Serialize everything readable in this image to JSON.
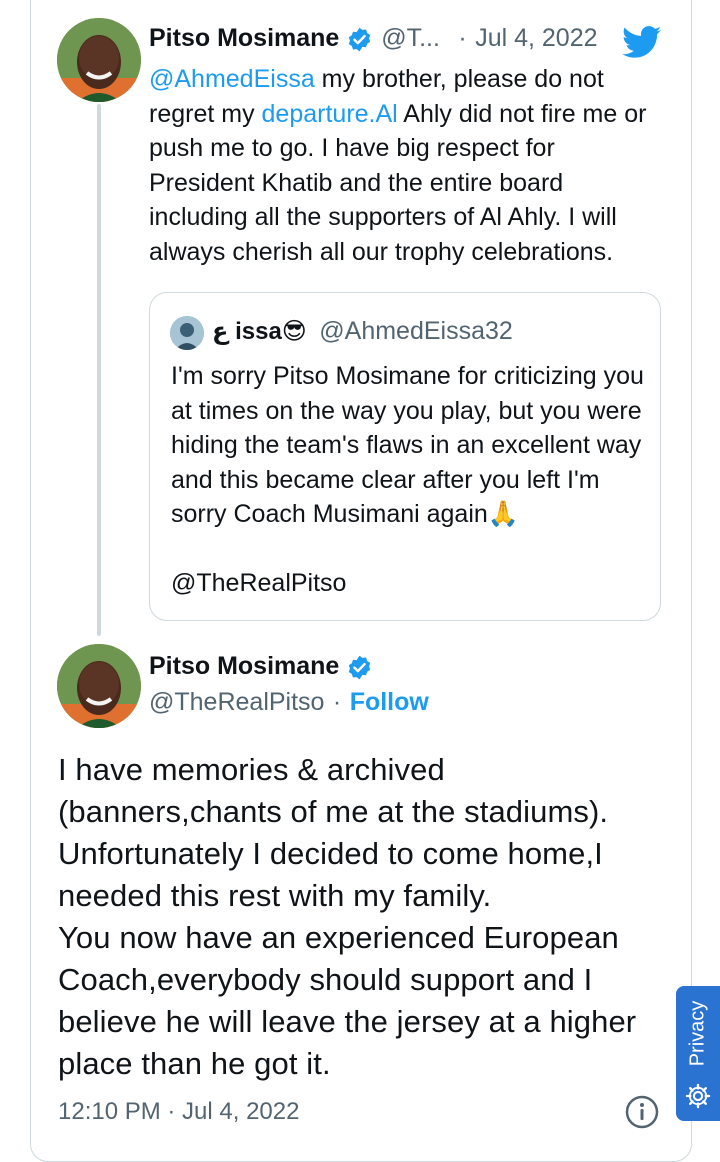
{
  "reply_tweet": {
    "author_name": "Pitso Mosimane",
    "author_handle": "@T...",
    "separator": "·",
    "date": "Jul 4, 2022",
    "mention": "@AhmedEissa",
    "text_part1": " my brother, please do not regret my ",
    "link_text": "departure.Al",
    "text_part2": " Ahly did not fire me or push me to go. I have big respect for President Khatib and the entire board including all the supporters of Al Ahly. I will always cherish all our trophy celebrations."
  },
  "quoted_tweet": {
    "author_name": "ع issa😎",
    "author_handle": "@AhmedEissa32",
    "text": "I'm sorry Pitso Mosimane for criticizing you at times on the way you play, but you were hiding the team's flaws in an excellent way and this became clear after you left I'm sorry Coach Musimani again🙏",
    "mention": "@TheRealPitso"
  },
  "main_tweet": {
    "author_name": "Pitso Mosimane",
    "author_handle": "@TheRealPitso",
    "separator": "·",
    "follow_label": "Follow",
    "text": "I have memories & archived (banners,chants of me at the stadiums). Unfortunately I decided to come home,I needed this rest with my family.\nYou now have an experienced European Coach,everybody should support and I believe he will leave the jersey at a higher place than he got it.",
    "timestamp": "12:10 PM · Jul 4, 2022"
  },
  "privacy_badge": {
    "label": "Privacy"
  },
  "colors": {
    "accent": "#1d9bf0",
    "muted": "#536471",
    "border": "#cfd9de",
    "privacy_bg": "#2b73d1"
  }
}
